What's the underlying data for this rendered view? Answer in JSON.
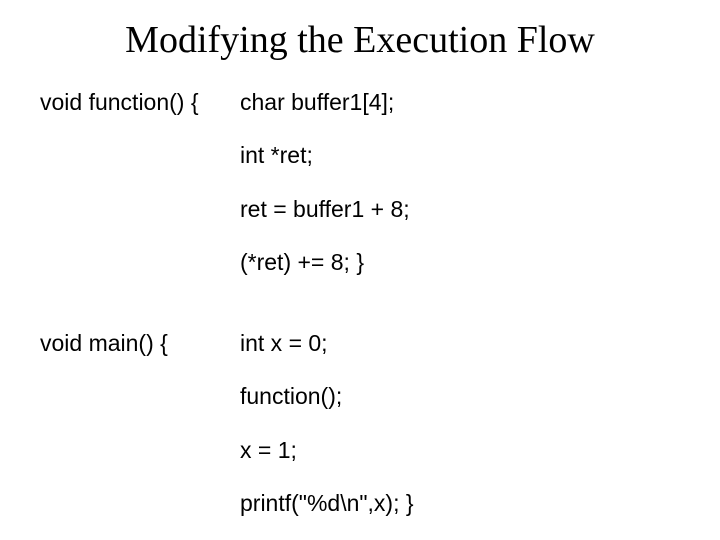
{
  "title": "Modifying the Execution Flow",
  "code": {
    "func_sig": "void function() {",
    "func_line1": "char buffer1[4];",
    "func_line2": "int *ret;",
    "func_line3": "ret = buffer1 + 8;",
    "func_line4": "(*ret) += 8; }",
    "main_sig": "void main() {",
    "main_line1": "int x = 0;",
    "main_line2": "function();",
    "main_line3": "x = 1;",
    "main_line4": "printf(\"%d\\n\",x);  }"
  }
}
